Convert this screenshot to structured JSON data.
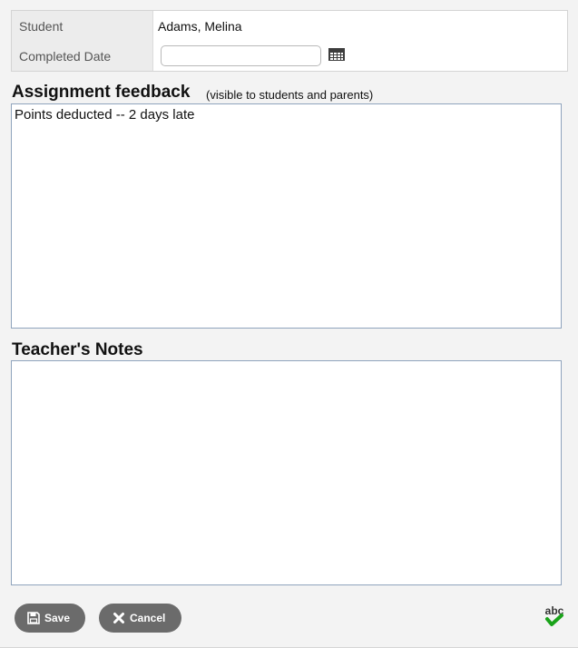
{
  "student_info": {
    "student_label": "Student",
    "student_value": "Adams, Melina",
    "completed_date_label": "Completed Date",
    "completed_date_value": ""
  },
  "assignment_feedback": {
    "heading": "Assignment feedback",
    "note": "(visible to students and parents)",
    "text": "Points deducted -- 2 days late"
  },
  "teachers_notes": {
    "heading": "Teacher's Notes",
    "text": ""
  },
  "buttons": {
    "save_label": "Save",
    "cancel_label": "Cancel"
  },
  "spell_check": {
    "label": "abc",
    "icon": "spell-check-icon",
    "check_color": "#1aa31a"
  },
  "colors": {
    "background": "#f3f3f3",
    "button": "#6b6b6b",
    "textarea_border": "#8fa4bd"
  }
}
